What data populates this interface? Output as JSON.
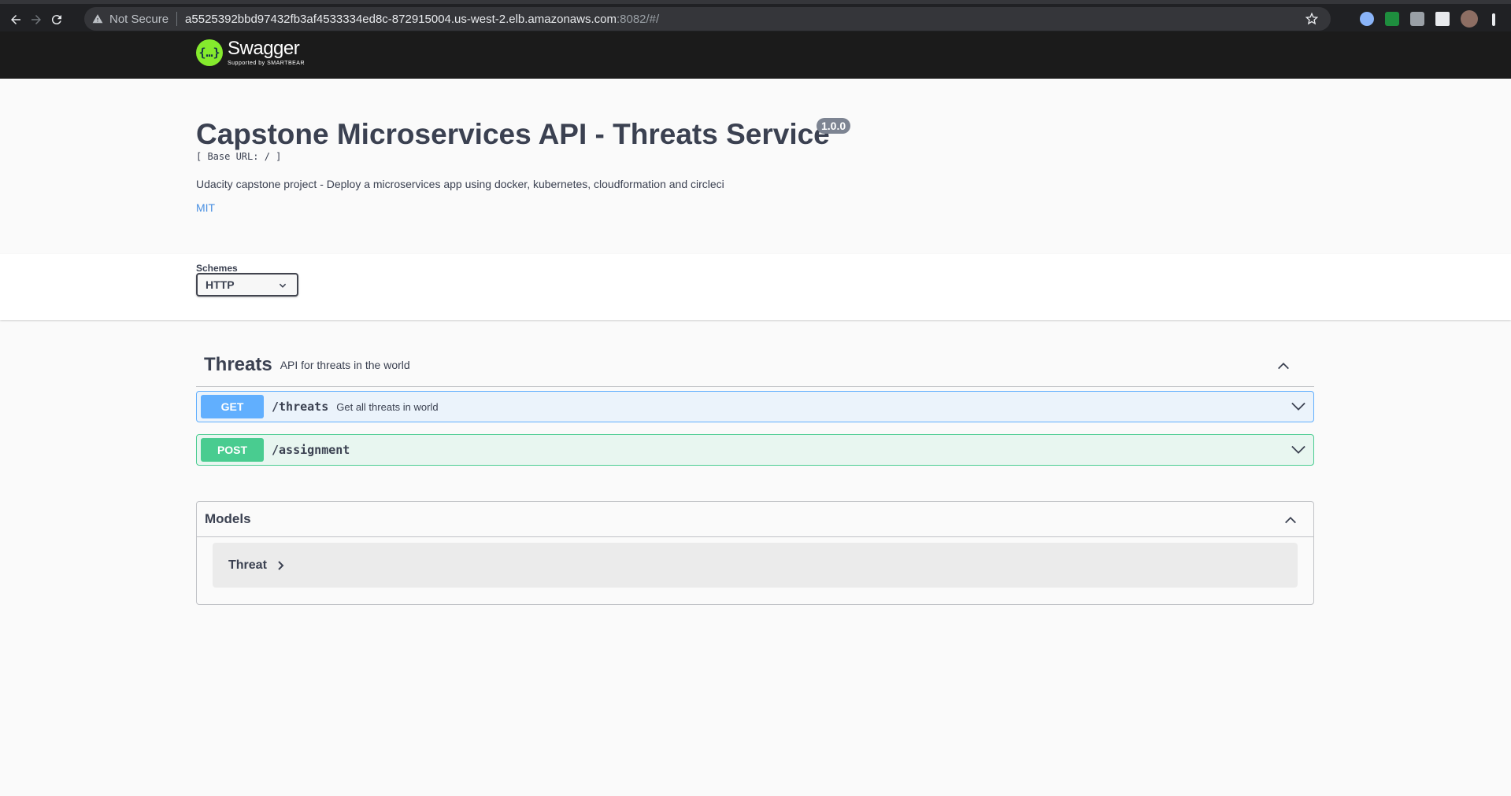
{
  "browser": {
    "security_label": "Not Secure",
    "url_host": "a5525392bbd97432fb3af4533334ed8c-872915004.us-west-2.elb.amazonaws.com",
    "url_rest": ":8082/#/"
  },
  "topbar": {
    "logo_mark": "{…}",
    "logo_name": "Swagger",
    "logo_sub": "Supported by SMARTBEAR"
  },
  "info": {
    "title": "Capstone Microservices API - Threats Service",
    "version": "1.0.0",
    "base_url": "[ Base URL: / ]",
    "description": "Udacity capstone project - Deploy a microservices app using docker, kubernetes, cloudformation and circleci",
    "license": "MIT"
  },
  "schemes": {
    "label": "Schemes",
    "selected": "HTTP"
  },
  "tag": {
    "name": "Threats",
    "description": "API for threats in the world"
  },
  "operations": [
    {
      "method": "GET",
      "path": "/threats",
      "summary": "Get all threats in world"
    },
    {
      "method": "POST",
      "path": "/assignment",
      "summary": ""
    }
  ],
  "models": {
    "title": "Models",
    "items": [
      {
        "name": "Threat"
      }
    ]
  },
  "colors": {
    "get": "#61affe",
    "post": "#49cc90",
    "logo": "#85ea2d"
  }
}
